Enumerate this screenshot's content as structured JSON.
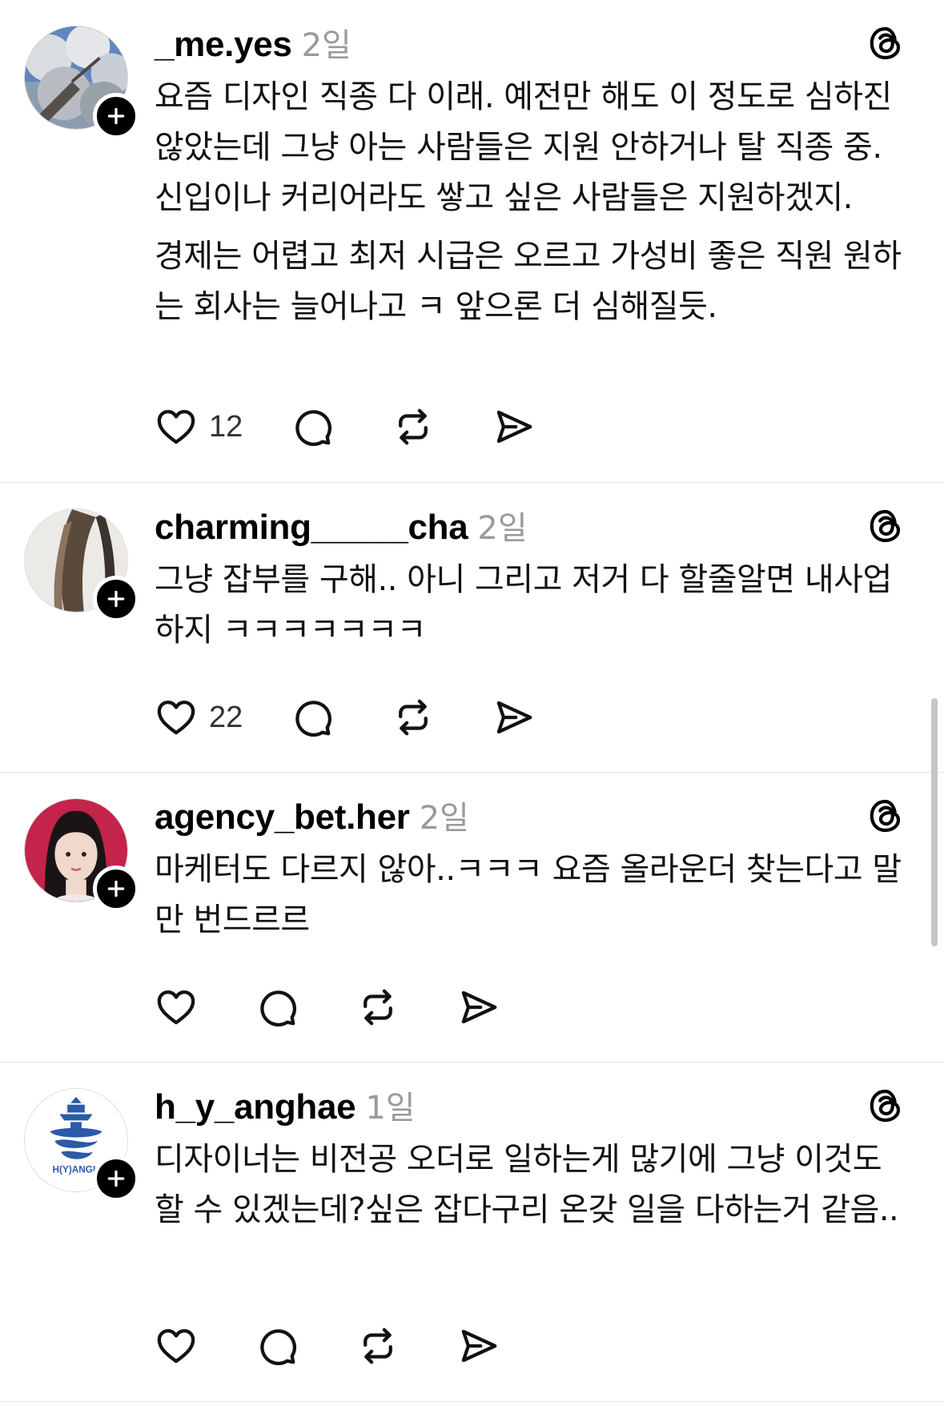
{
  "posts": [
    {
      "username": "_me.yes",
      "time": "2일",
      "paragraphs": [
        "요즘 디자인 직종 다 이래. 예전만 해도 이 정도로 심하진 않았는데 그냥 아는 사람들은 지원 안하거나 탈 직종 중. 신입이나 커리어라도 쌓고 싶은 사람들은 지원하겠지.",
        "경제는 어렵고 최저 시급은 오르고 가성비 좋은 직원 원하는 회사는 늘어나고 ㅋ 앞으론 더 심해질듯."
      ],
      "likes": "12"
    },
    {
      "username": "charming_____cha",
      "time": "2일",
      "paragraphs": [
        "그냥 잡부를 구해.. 아니 그리고 저거 다 할줄알면 내사업하지 ㅋㅋㅋㅋㅋㅋㅋ"
      ],
      "likes": "22"
    },
    {
      "username": "agency_bet.her",
      "time": "2일",
      "paragraphs": [
        "마케터도 다르지 않아..ㅋㅋㅋ 요즘 올라운더 찾는다고 말만 번드르르"
      ],
      "likes": ""
    },
    {
      "username": "h_y_anghae",
      "time": "1일",
      "paragraphs": [
        "디자이너는 비전공 오더로 일하는게 많기에 그냥 이것도 할 수 있겠는데?싶은 잡다구리 온갖 일을 다하는거 같음.."
      ],
      "likes": ""
    }
  ],
  "avatar4_logo_text": "H(Y)ANGH",
  "icons": {
    "follow": "plus-icon",
    "app": "threads-icon",
    "like": "heart-icon",
    "reply": "comment-icon",
    "repost": "repost-icon",
    "share": "send-icon"
  },
  "colors": {
    "text": "#000000",
    "muted": "#9a9a9a",
    "divider": "#e3e3e3",
    "avatar4_brand": "#2b5aa8",
    "avatar3_bg": "#c4234a"
  }
}
